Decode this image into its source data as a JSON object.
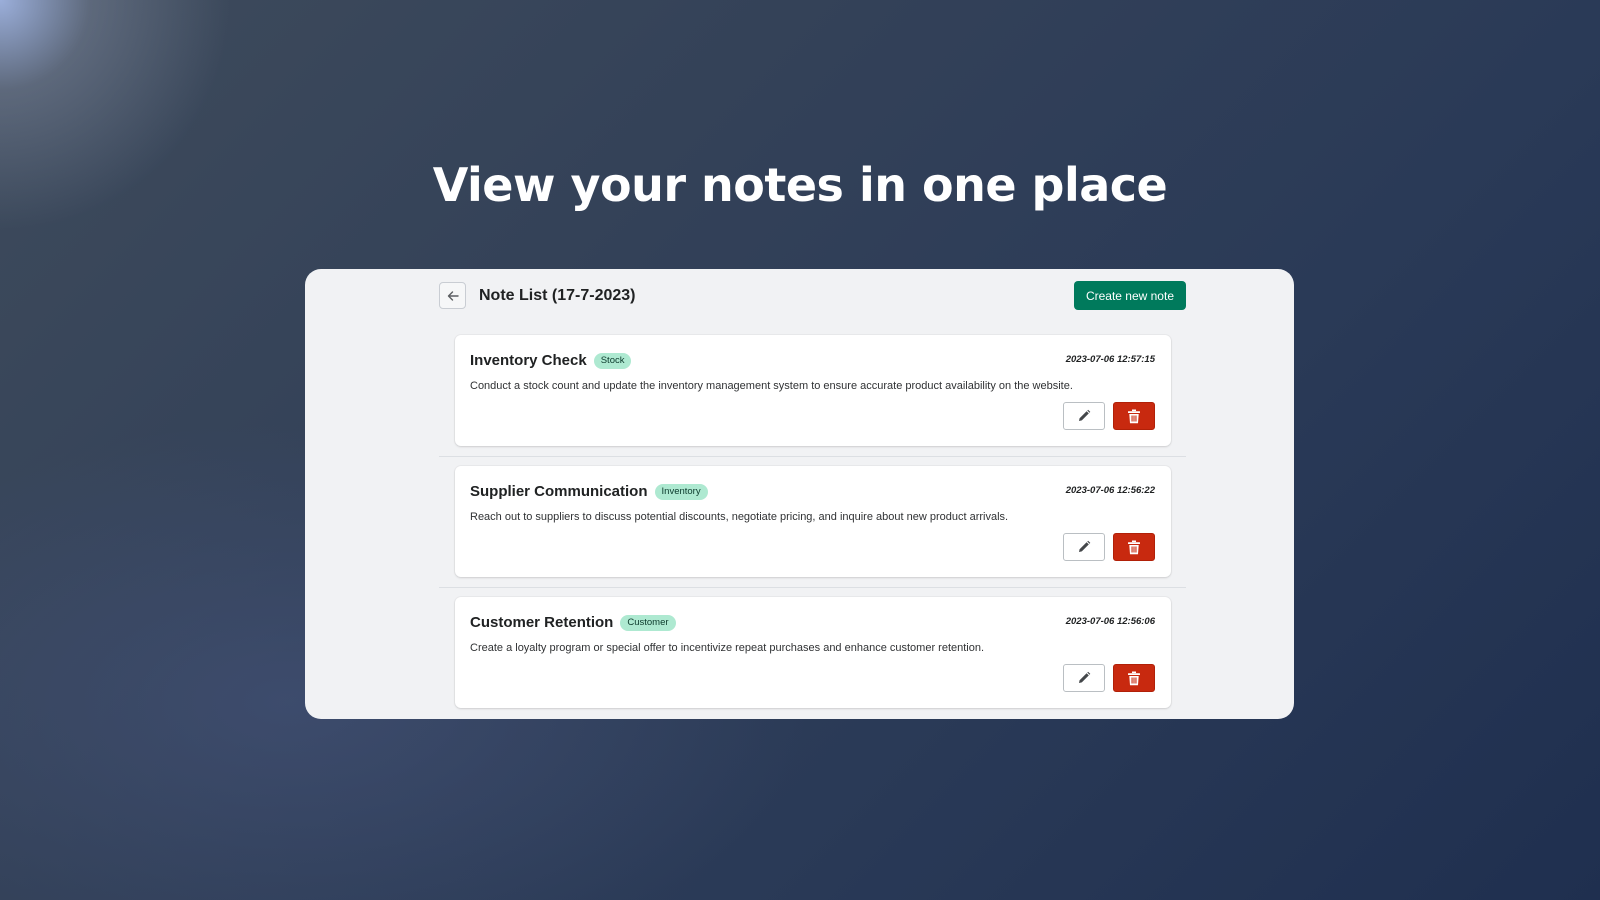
{
  "headline": "View your notes in one place",
  "header": {
    "back_icon": "arrow-left-icon",
    "title": "Note List (17-7-2023)",
    "create_label": "Create new note"
  },
  "notes": [
    {
      "title": "Inventory Check",
      "tag": "Stock",
      "date": "2023-07-06 12:57:15",
      "body": "Conduct a stock count and update the inventory management system to ensure accurate product availability on the website."
    },
    {
      "title": "Supplier Communication",
      "tag": "Inventory",
      "date": "2023-07-06 12:56:22",
      "body": "Reach out to suppliers to discuss potential discounts, negotiate pricing, and inquire about new product arrivals."
    },
    {
      "title": "Customer Retention",
      "tag": "Customer",
      "date": "2023-07-06 12:56:06",
      "body": "Create a loyalty program or special offer to incentivize repeat purchases and enhance customer retention."
    }
  ],
  "icons": {
    "edit": "pencil-icon",
    "delete": "trash-icon"
  },
  "colors": {
    "primary": "#007a5c",
    "danger": "#c8290f",
    "tag_bg": "#aee9d1",
    "panel_bg": "#f1f2f4"
  }
}
